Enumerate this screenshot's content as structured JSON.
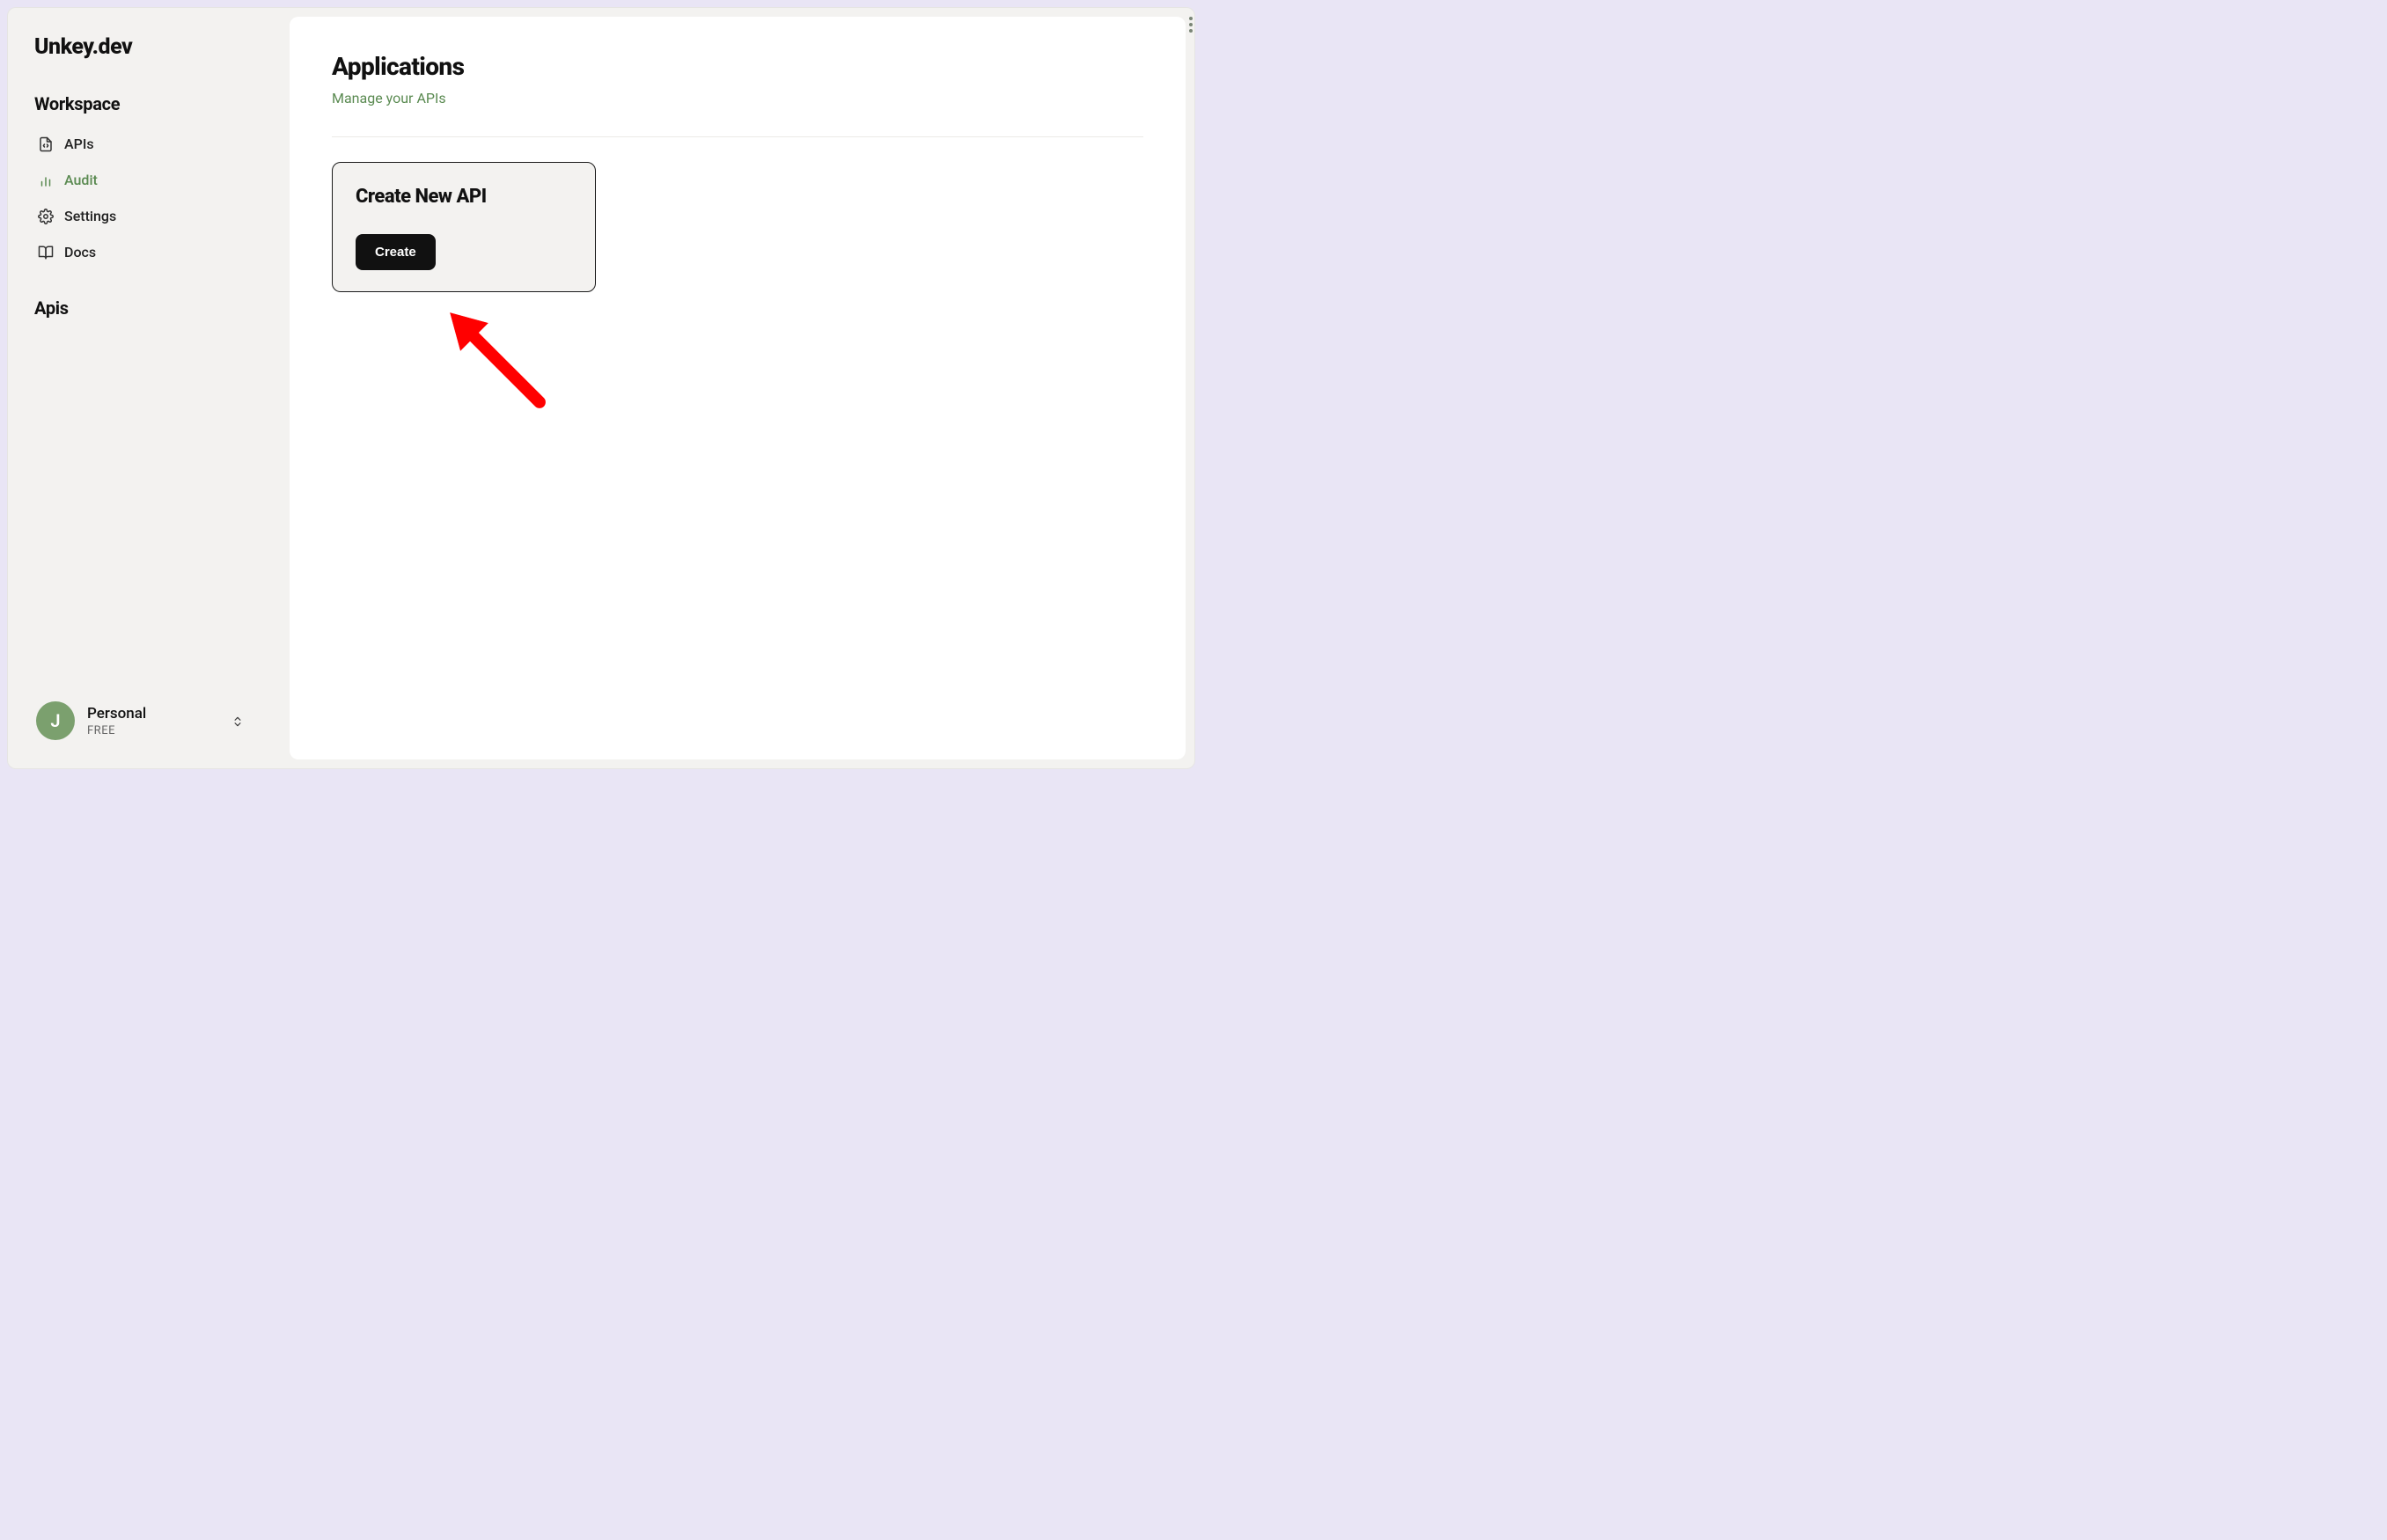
{
  "brand": "Unkey.dev",
  "sidebar": {
    "workspace_heading": "Workspace",
    "apis_heading": "Apis",
    "items": [
      {
        "label": "APIs",
        "icon": "file-code-icon",
        "active": false
      },
      {
        "label": "Audit",
        "icon": "bar-chart-icon",
        "active": true
      },
      {
        "label": "Settings",
        "icon": "gear-icon",
        "active": false
      },
      {
        "label": "Docs",
        "icon": "book-open-icon",
        "active": false
      }
    ]
  },
  "workspace_switcher": {
    "avatar_initial": "J",
    "name": "Personal",
    "plan": "FREE"
  },
  "page": {
    "title": "Applications",
    "subtitle": "Manage your APIs"
  },
  "create_card": {
    "title": "Create New API",
    "button_label": "Create"
  },
  "colors": {
    "accent_green": "#5a8a51",
    "bg_lilac": "#e9e5f5",
    "panel_grey": "#f3f2f0",
    "ink": "#111111"
  }
}
